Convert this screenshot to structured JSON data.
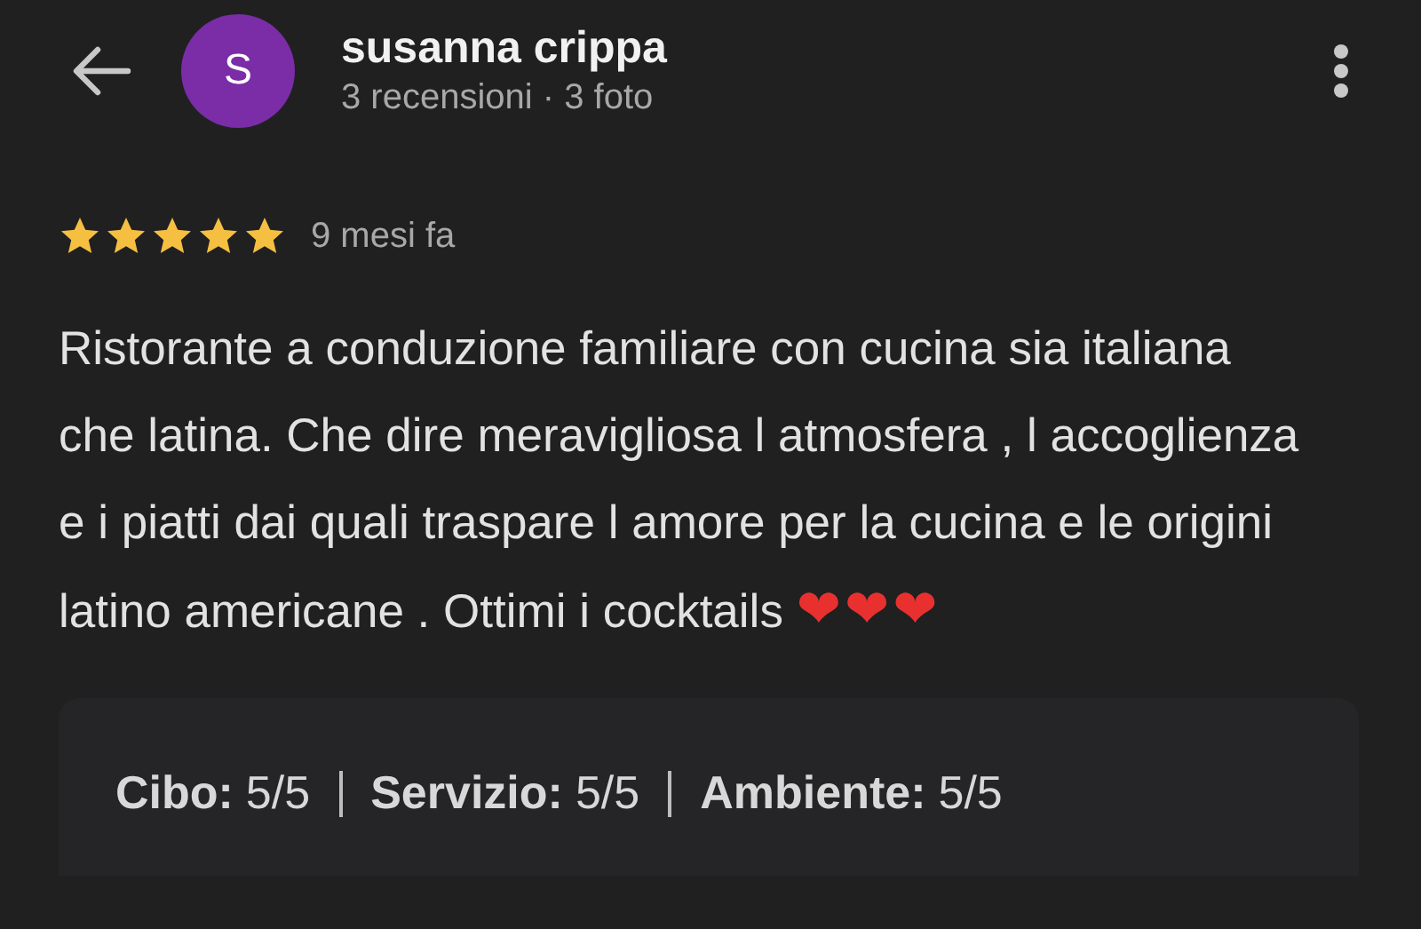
{
  "reviewer": {
    "initial": "S",
    "name": "susanna crippa",
    "meta": "3 recensioni · 3 foto"
  },
  "review": {
    "stars": 5,
    "time": "9 mesi fa",
    "text": "Ristorante a conduzione familiare con cucina sia italiana che latina. Che dire meravigliosa l atmosfera , l accoglienza e i piatti dai quali traspare l amore per la cucina e le origini latino americane . Ottimi i cocktails",
    "emoji": "❤❤❤"
  },
  "ratings": [
    {
      "label": "Cibo:",
      "value": "5/5"
    },
    {
      "label": "Servizio:",
      "value": "5/5"
    },
    {
      "label": "Ambiente:",
      "value": "5/5"
    }
  ]
}
